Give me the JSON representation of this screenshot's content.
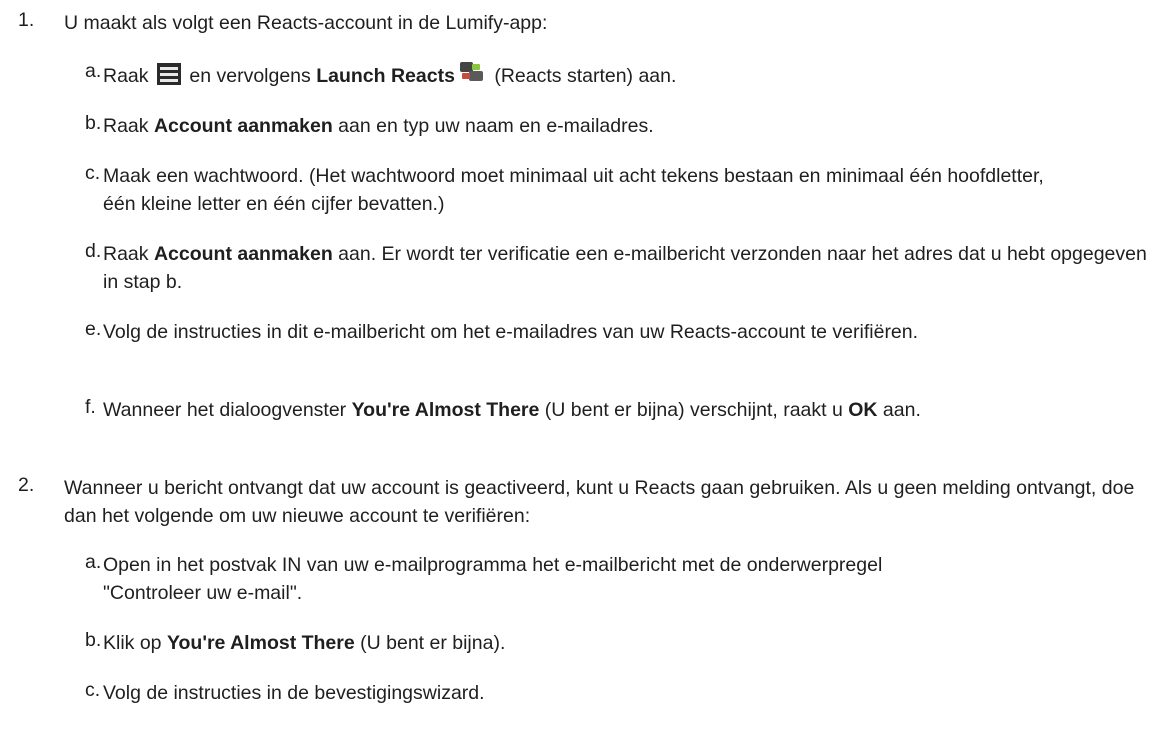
{
  "steps": [
    {
      "num": "1.",
      "text": "U maakt als volgt een Reacts-account in de Lumify-app:",
      "substeps": [
        {
          "letter": "a.",
          "pre": "Raak ",
          "icon1": "menu-icon",
          "mid": " en vervolgens ",
          "bold": "Launch Reacts",
          "icon2": "reacts-icon",
          "post": " (Reacts starten) aan."
        },
        {
          "letter": "b.",
          "pre": "Raak ",
          "bold": "Account aanmaken",
          "post": " aan en typ uw naam en e-mailadres."
        },
        {
          "letter": "c.",
          "text": "Maak een wachtwoord. (Het wachtwoord moet minimaal uit acht tekens bestaan en minimaal één hoofdletter, één kleine letter en één cijfer bevatten.)"
        },
        {
          "letter": "d.",
          "pre": "Raak ",
          "bold": "Account aanmaken",
          "post": " aan. Er wordt ter verificatie een e-mailbericht verzonden naar het adres dat u hebt opgegeven in stap b."
        },
        {
          "letter": "e.",
          "text": "Volg de instructies in dit e-mailbericht om het e-mailadres van uw Reacts-account te verifiëren."
        },
        {
          "letter": "f.",
          "pre": "Wanneer het dialoogvenster ",
          "bold": "You're Almost There",
          "mid": " (U bent er bijna) verschijnt, raakt u ",
          "bold2": "OK",
          "post": " aan."
        }
      ]
    },
    {
      "num": "2.",
      "text": "Wanneer u bericht ontvangt dat uw account is geactiveerd, kunt u Reacts gaan gebruiken. Als u geen melding ontvangt, doe dan het volgende om uw nieuwe account te verifiëren:",
      "substeps": [
        {
          "letter": "a.",
          "text": "Open in het postvak IN van uw e-mailprogramma het e-mailbericht met de onderwerpregel \"Controleer uw e-mail\"."
        },
        {
          "letter": "b.",
          "pre": "Klik op ",
          "bold": "You're Almost There",
          "post": " (U bent er bijna)."
        },
        {
          "letter": "c.",
          "text": "Volg de instructies in de bevestigingswizard."
        }
      ]
    }
  ]
}
